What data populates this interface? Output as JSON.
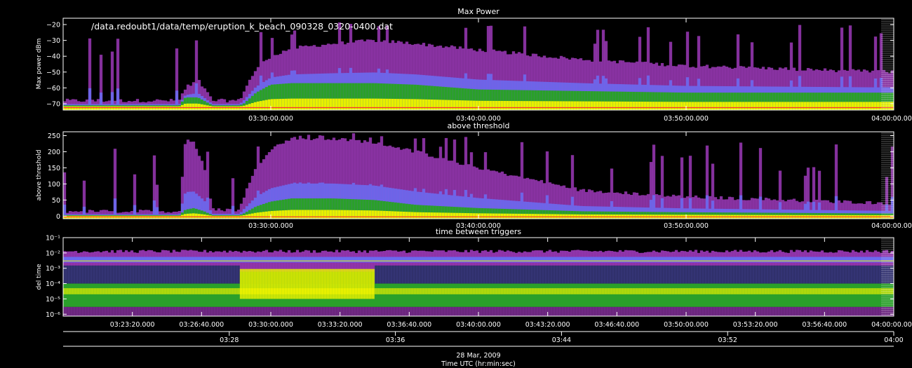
{
  "filename": "/data.redoubt1/data/temp/eruption_k_beach_090328_0320-0400.dat",
  "footer": {
    "date": "28 Mar, 2009",
    "xlabel": "Time UTC (hr:min:sec)"
  },
  "colors": {
    "background": "#000000",
    "axes": "#ffffff",
    "magenta": "#b040d0",
    "blue": "#6a6af0",
    "green": "#2aa02a",
    "yellow": "#e6f000",
    "red": "#ff3030"
  },
  "chart_data": [
    {
      "type": "scatter",
      "title": "Max Power",
      "ylabel": "Max power dBm",
      "ylim": [
        -74,
        -16
      ],
      "yticks": [
        -70,
        -60,
        -50,
        -40,
        -30,
        -20
      ],
      "yticklabels": [
        "−70",
        "−60",
        "−50",
        "−40",
        "−30",
        "−20"
      ],
      "xlim": [
        "03:20:00",
        "04:00:00"
      ],
      "xtick_values": [
        "03:30:00",
        "03:40:00",
        "03:50:00",
        "04:00:00"
      ],
      "xticklabels": [
        "03:30:00.000",
        "03:40:00.000",
        "03:50:00.000",
        "04:00:00.000"
      ],
      "density_profile": {
        "x_min": [
          20,
          25.6,
          25.9,
          26.5,
          27.2,
          28.5,
          28.7,
          29.3,
          30,
          31,
          33,
          35,
          37,
          40,
          45,
          50,
          55,
          60
        ],
        "floor": [
          -72,
          -72,
          -72,
          -72,
          -72,
          -72,
          -72,
          -72,
          -72,
          -72,
          -72,
          -72,
          -72,
          -72,
          -72,
          -72,
          -72,
          -72
        ],
        "core_top": [
          -71,
          -71,
          -66,
          -66,
          -71,
          -71,
          -70,
          -63,
          -58,
          -57,
          -57,
          -57,
          -58,
          -61,
          -62,
          -63,
          -63,
          -63
        ],
        "envelope_top": [
          -68,
          -68,
          -60,
          -55,
          -68,
          -68,
          -62,
          -48,
          -40,
          -35,
          -32,
          -30,
          -32,
          -36,
          -42,
          -46,
          -48,
          -50
        ]
      }
    },
    {
      "type": "scatter",
      "title": "above threshold",
      "ylabel": "above threshold",
      "ylim": [
        -8,
        262
      ],
      "yticks": [
        0,
        50,
        100,
        150,
        200,
        250
      ],
      "yticklabels": [
        "0",
        "50",
        "100",
        "150",
        "200",
        "250"
      ],
      "xlim": [
        "03:20:00",
        "04:00:00"
      ],
      "xtick_values": [
        "03:30:00",
        "03:40:00",
        "03:50:00",
        "04:00:00"
      ],
      "xticklabels": [
        "03:30:00.000",
        "03:40:00.000",
        "03:50:00.000",
        "04:00:00.000"
      ],
      "density_profile": {
        "x_min": [
          20,
          25.6,
          25.9,
          26.3,
          26.8,
          27.2,
          28.5,
          28.7,
          29.3,
          30,
          31,
          33,
          35,
          37,
          40,
          45,
          50,
          55,
          60
        ],
        "floor": [
          0,
          0,
          0,
          0,
          0,
          0,
          0,
          0,
          0,
          0,
          0,
          0,
          0,
          0,
          0,
          0,
          0,
          0,
          0
        ],
        "core_top": [
          3,
          3,
          20,
          25,
          15,
          3,
          3,
          8,
          30,
          45,
          55,
          55,
          50,
          35,
          25,
          15,
          12,
          10,
          8
        ],
        "envelope_top": [
          15,
          15,
          240,
          230,
          150,
          20,
          20,
          60,
          150,
          210,
          240,
          240,
          230,
          200,
          150,
          80,
          60,
          50,
          40
        ]
      }
    },
    {
      "type": "scatter",
      "title": "time between triggers",
      "ylabel": "del time",
      "yscale": "log",
      "ylim": [
        7.5e-07,
        0.1
      ],
      "yticks": [
        1e-06,
        1e-05,
        0.0001,
        0.001,
        0.01,
        0.1
      ],
      "yticklabels": [
        "10⁻⁶",
        "10⁻⁵",
        "10⁻⁴",
        "10⁻³",
        "10⁻²",
        "10⁻¹"
      ],
      "xlim": [
        "03:20:00",
        "04:00:00"
      ],
      "xtick_values": [
        "03:23:20",
        "03:26:40",
        "03:30:00",
        "03:33:20",
        "03:36:40",
        "03:40:00",
        "03:43:20",
        "03:46:40",
        "03:50:00",
        "03:53:20",
        "03:56:40",
        "04:00:00"
      ],
      "xticklabels": [
        "03:23:20.000",
        "03:26:40.000",
        "03:30:00.000",
        "03:33:20.000",
        "03:36:40.000",
        "03:40:00.000",
        "03:43:20.000",
        "03:46:40.000",
        "03:50:00.000",
        "03:53:20.000",
        "03:56:40.000",
        "04:00:00.000"
      ],
      "bands": {
        "upper_band": [
          0.0015,
          0.01
        ],
        "lower_band": [
          3e-06,
          0.0001
        ],
        "eruption_interval": [
          "03:28:30",
          "03:35:00"
        ]
      }
    }
  ],
  "time_axis": {
    "tick_values": [
      "03:28",
      "03:36",
      "03:44",
      "03:52",
      "04:00"
    ],
    "ticklabels": [
      "03:28",
      "03:36",
      "03:44",
      "03:52",
      "04:00"
    ]
  }
}
